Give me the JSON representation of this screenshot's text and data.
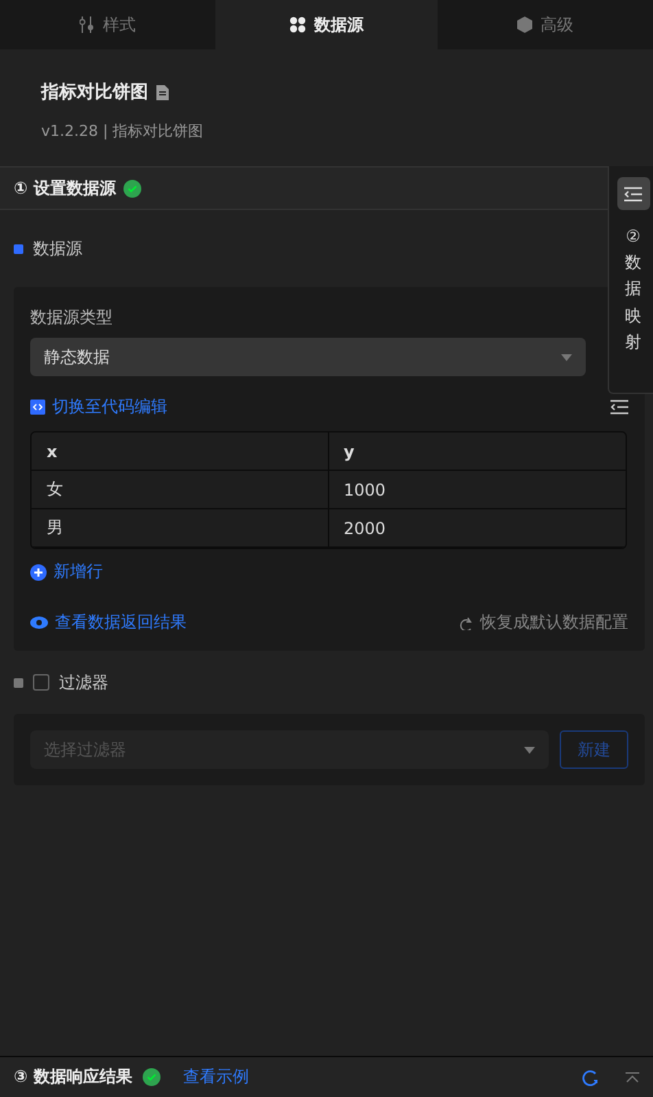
{
  "tabs": [
    {
      "label": "样式",
      "selected": false
    },
    {
      "label": "数据源",
      "selected": true
    },
    {
      "label": "高级",
      "selected": false
    }
  ],
  "component": {
    "title": "指标对比饼图",
    "version": "v1.2.28 | 指标对比饼图"
  },
  "step1": {
    "title": "① 设置数据源",
    "done": true
  },
  "side_panel": {
    "label": "②数据映射"
  },
  "datasource": {
    "heading": "数据源",
    "type_label": "数据源类型",
    "type_value": "静态数据",
    "code_link": "切换至代码编辑",
    "table": {
      "columns": [
        "x",
        "y"
      ],
      "rows": [
        [
          "女",
          "1000"
        ],
        [
          "男",
          "2000"
        ]
      ]
    },
    "add_row": "新增行",
    "view_result": "查看数据返回结果",
    "reset": "恢复成默认数据配置"
  },
  "filter": {
    "label": "过滤器",
    "checked": false,
    "placeholder": "选择过滤器",
    "button": "新建"
  },
  "step3": {
    "title": "③ 数据响应结果",
    "done": true,
    "link": "查看示例"
  }
}
